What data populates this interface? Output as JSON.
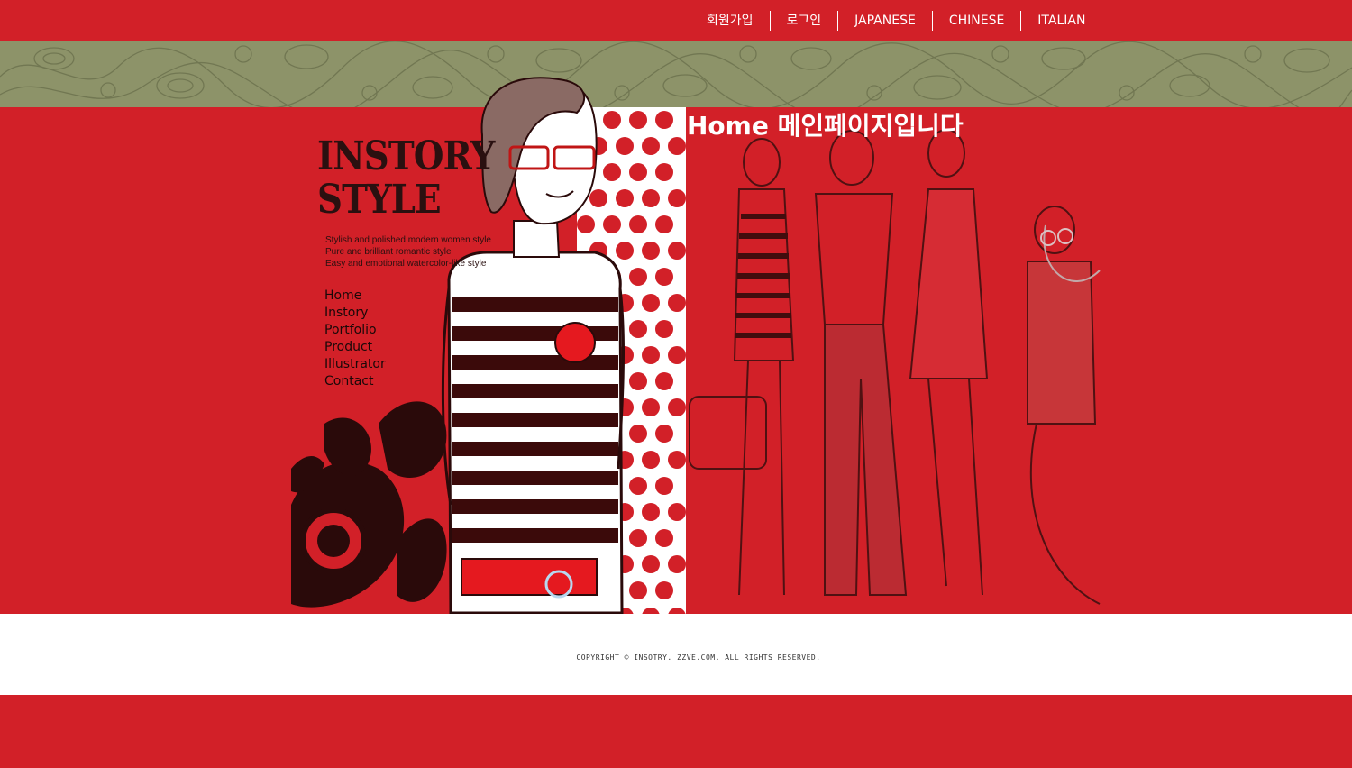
{
  "topnav": {
    "items": [
      {
        "label": "회원가입"
      },
      {
        "label": "로그인"
      },
      {
        "label": "JAPANESE"
      },
      {
        "label": "CHINESE"
      },
      {
        "label": "ITALIAN"
      }
    ]
  },
  "brand": {
    "line1": "INSTORY",
    "line2": "STYLE",
    "tagline": [
      "Stylish and polished modern women style",
      "Pure and brilliant romantic style",
      "Easy and emotional watercolor-like style"
    ]
  },
  "sidenav": {
    "items": [
      {
        "label": "Home"
      },
      {
        "label": "Instory"
      },
      {
        "label": "Portfolio"
      },
      {
        "label": "Product"
      },
      {
        "label": "Illustrator"
      },
      {
        "label": "Contact"
      }
    ]
  },
  "main": {
    "headline": "Home 메인페이지입니다"
  },
  "footer": {
    "copyright": "COPYRIGHT © INSOTRY. ZZVE.COM. ALL RIGHTS RESERVED."
  },
  "colors": {
    "primary_red": "#d22028",
    "band_olive": "#8d9369",
    "dark": "#2a1010",
    "white": "#ffffff"
  }
}
